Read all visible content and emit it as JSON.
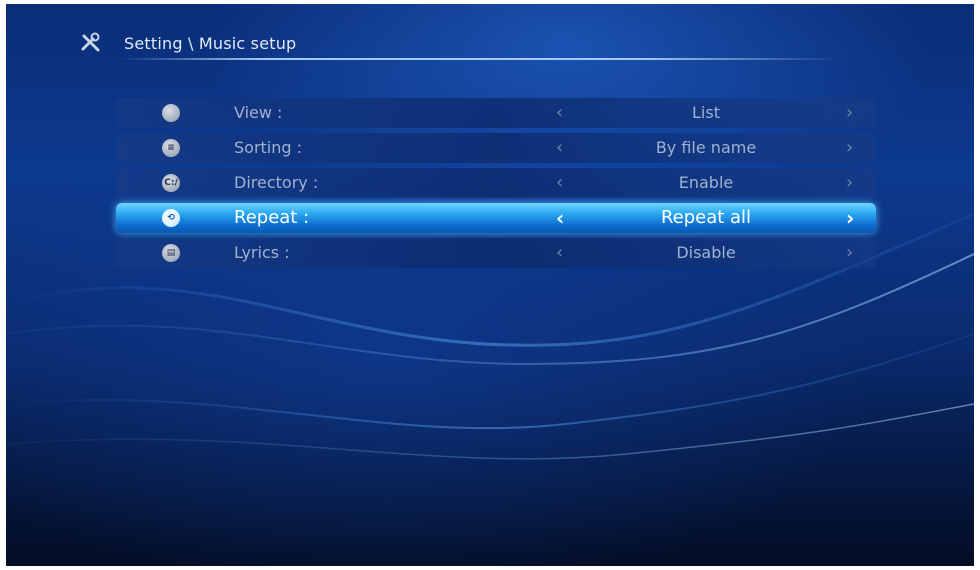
{
  "header": {
    "icon": "tools-icon",
    "breadcrumb": "Setting \\ Music setup"
  },
  "menu": {
    "selected_index": 3,
    "items": [
      {
        "label": "View  :",
        "value": "List",
        "icon": "view-icon",
        "icon_glyph": ""
      },
      {
        "label": "Sorting  :",
        "value": "By file name",
        "icon": "sorting-icon",
        "icon_glyph": "≡"
      },
      {
        "label": "Directory  :",
        "value": "Enable",
        "icon": "directory-icon",
        "icon_glyph": "C:/"
      },
      {
        "label": "Repeat  :",
        "value": "Repeat all",
        "icon": "repeat-icon",
        "icon_glyph": "⟲"
      },
      {
        "label": "Lyrics  :",
        "value": "Disable",
        "icon": "lyrics-icon",
        "icon_glyph": "▤"
      }
    ],
    "arrow_left": "‹",
    "arrow_right": "›"
  },
  "colors": {
    "background": "#0a2d77",
    "highlight": "#2aa8f0",
    "text_dim": "#9fb2cf",
    "text_active": "#ffffff"
  }
}
